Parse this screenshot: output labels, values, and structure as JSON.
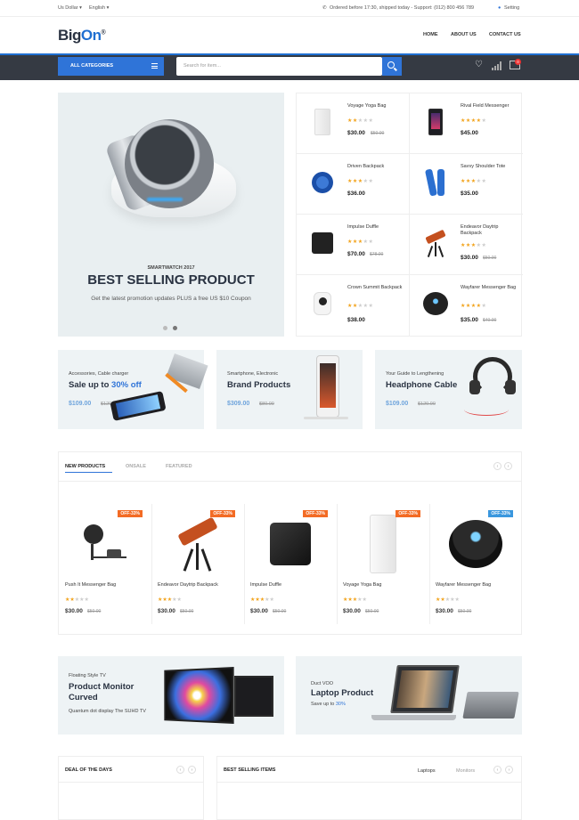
{
  "topbar": {
    "currency": "Us Dollar",
    "language": "English",
    "notice": "Ordered before 17:30, shipped today - Support: (012) 800 456 789",
    "setting": "Setting"
  },
  "header": {
    "logo_main": "Big",
    "logo_accent": "On",
    "logo_mark": "®",
    "nav": [
      "HOME",
      "ABOUT US",
      "CONTACT US"
    ]
  },
  "searchbar": {
    "all_categories": "ALL CATEGORIES",
    "placeholder": "Search for item...",
    "cart_count": "0"
  },
  "hero": {
    "kicker": "SMARTWATCH 2017",
    "title": "BEST SELLING PRODUCT",
    "subtitle": "Get the latest promotion updates PLUS a free US $10 Coupon",
    "slides": 2,
    "active_slide": 2
  },
  "side_products": [
    {
      "name": "Voyage Yoga Bag",
      "rating": 2,
      "price": "$30.00",
      "old": "$50.00",
      "icon": "power-bank"
    },
    {
      "name": "Rival Field Messenger",
      "rating": 4,
      "price": "$45.00",
      "old": "",
      "icon": "phone"
    },
    {
      "name": "Driven Backpack",
      "rating": 3,
      "price": "$36.00",
      "old": "",
      "icon": "speaker"
    },
    {
      "name": "Savvy Shoulder Tote",
      "rating": 3,
      "price": "$35.00",
      "old": "",
      "icon": "remote"
    },
    {
      "name": "Impulse Duffle",
      "rating": 3,
      "price": "$70.00",
      "old": "$78.00",
      "icon": "charger"
    },
    {
      "name": "Endeavor Daytrip Backpack",
      "rating": 3,
      "price": "$30.00",
      "old": "$50.00",
      "icon": "telescope"
    },
    {
      "name": "Crown Summit Backpack",
      "rating": 2,
      "price": "$38.00",
      "old": "",
      "icon": "camera"
    },
    {
      "name": "Wayfarer Messenger Bag",
      "rating": 4,
      "price": "$35.00",
      "old": "$40.00",
      "icon": "sphere-speaker"
    }
  ],
  "banners": [
    {
      "kicker": "Accessories, Cable charger",
      "title": "Sale up to ",
      "accent": "30% off",
      "price": "$109.00",
      "old": "$120.00"
    },
    {
      "kicker": "Smartphone, Electronic",
      "title": "Brand Products",
      "accent": "",
      "price": "$309.00",
      "old": "$80.00"
    },
    {
      "kicker": "Your Guide to Lengthening",
      "title": "Headphone Cable",
      "accent": "",
      "price": "$109.00",
      "old": "$120.00"
    }
  ],
  "new_products": {
    "tabs": [
      "NEW PRODUCTS",
      "ONSALE",
      "FEATURED"
    ],
    "items": [
      {
        "name": "Push It Messenger Bag",
        "badge": "OFF-33%",
        "badge_color": "#f36b24",
        "rating": 2,
        "price": "$30.00",
        "old": "$50.00",
        "icon": "gps-device"
      },
      {
        "name": "Endeavor Daytrip Backpack",
        "badge": "OFF-33%",
        "badge_color": "#f36b24",
        "rating": 3,
        "price": "$30.00",
        "old": "$50.00",
        "icon": "telescope"
      },
      {
        "name": "Impulse Duffle",
        "badge": "OFF-33%",
        "badge_color": "#f36b24",
        "rating": 3,
        "price": "$30.00",
        "old": "$50.00",
        "icon": "charger"
      },
      {
        "name": "Voyage Yoga Bag",
        "badge": "OFF-33%",
        "badge_color": "#f36b24",
        "rating": 3,
        "price": "$30.00",
        "old": "$50.00",
        "icon": "power-bank"
      },
      {
        "name": "Wayfarer Messenger Bag",
        "badge": "OFF-33%",
        "badge_color": "#3a97de",
        "rating": 2,
        "price": "$30.00",
        "old": "$50.00",
        "icon": "sphere-speaker"
      }
    ]
  },
  "tv_banners": [
    {
      "kicker": "Floating Style TV",
      "title_line1": "Product Monitor",
      "title_line2": "Curved",
      "sub": "Quantum dot display The SUHD TV"
    },
    {
      "kicker": "Duct VOO",
      "title_line1": "Laptop Product",
      "title_line2": "",
      "sub": "Save up to ",
      "accent": "30%"
    }
  ],
  "bottom": {
    "deal_title": "DEAL OF THE DAYS",
    "best_title": "BEST SELLING ITEMS",
    "best_tabs": [
      "Laptops",
      "Monitors"
    ]
  },
  "colors": {
    "accent": "#2f74d8",
    "dark": "#353a43",
    "star": "#f2a31b",
    "badge_orange": "#f36b24",
    "badge_blue": "#3a97de"
  }
}
